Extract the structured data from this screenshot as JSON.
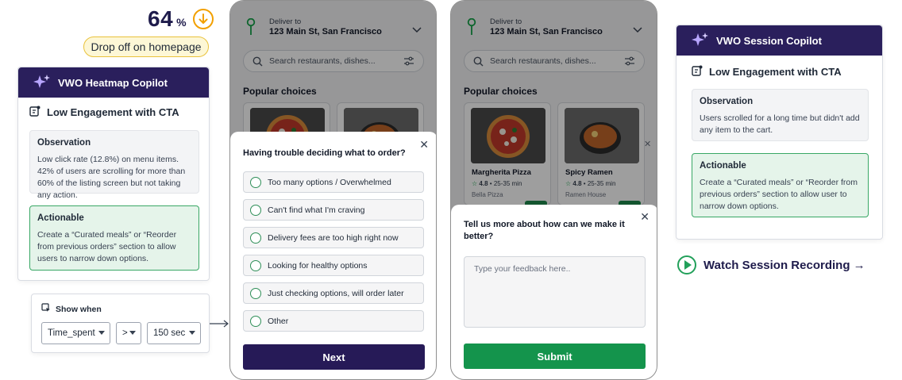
{
  "stat": {
    "value": "64",
    "unit": "%",
    "badge": "Drop off on homepage"
  },
  "heatmap_card": {
    "title": "VWO Heatmap Copilot",
    "subtitle": "Low Engagement with CTA",
    "observation": {
      "title": "Observation",
      "text": "Low click rate (12.8%) on menu items. 42% of users are scrolling for more than 60% of the listing screen but not taking any action."
    },
    "actionable": {
      "title": "Actionable",
      "text": "Create a “Curated meals” or “Reorder from previous orders” section to allow users to narrow down options."
    }
  },
  "show_when": {
    "title": "Show when",
    "metric": "Time_spent",
    "operator": ">",
    "value": "150 sec"
  },
  "phone_common": {
    "deliver_label": "Deliver to",
    "address": "123 Main St, San Francisco",
    "search_placeholder": "Search restaurants, dishes...",
    "section_title": "Popular choices"
  },
  "foods": [
    {
      "name": "Margherita Pizza",
      "rating": "4.8",
      "time": "25-35 min",
      "place": "Bella Pizza"
    },
    {
      "name": "Spicy Ramen",
      "rating": "4.8",
      "time": "25-35 min",
      "place": "Ramen House"
    }
  ],
  "survey": {
    "question": "Having trouble deciding what to order?",
    "options": [
      "Too many options / Overwhelmed",
      "Can't find what I'm craving",
      "Delivery fees are too high right now",
      "Looking for healthy options",
      "Just checking options, will order later",
      "Other"
    ],
    "next_label": "Next"
  },
  "feedback": {
    "question": "Tell us more about how can we make it better?",
    "placeholder": "Type your feedback here..",
    "submit_label": "Submit"
  },
  "session_card": {
    "title": "VWO Session Copilot",
    "subtitle": "Low Engagement with CTA",
    "observation": {
      "title": "Observation",
      "text": "Users scrolled for a long time but didn't add any item to the cart."
    },
    "actionable": {
      "title": "Actionable",
      "text": "Create a “Curated meals” or “Reorder from previous orders” section to allow user to narrow down options."
    }
  },
  "watch_link": "Watch Session Recording →",
  "colors": {
    "brand_dark": "#2a1f5c",
    "accent_green": "#14944c",
    "warning": "#f2a000"
  }
}
